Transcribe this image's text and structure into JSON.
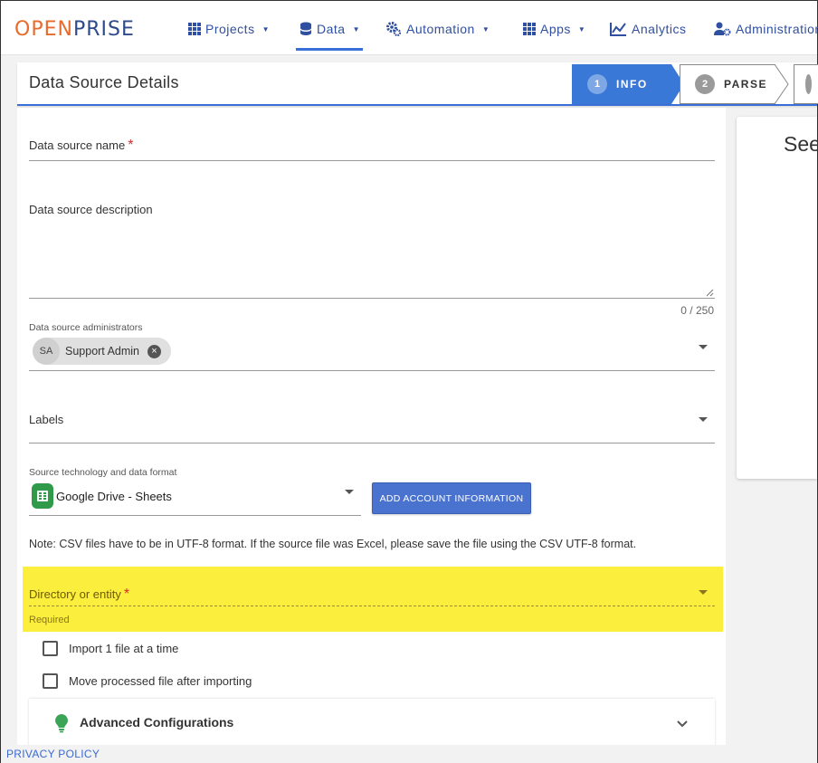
{
  "brand": {
    "open": "OPEN",
    "prise": "PRISE"
  },
  "nav": {
    "projects": "Projects",
    "data": "Data",
    "automation": "Automation",
    "apps": "Apps",
    "analytics": "Analytics",
    "administration": "Administration"
  },
  "header": {
    "title": "Data Source Details",
    "steps": [
      {
        "num": "1",
        "label": "INFO"
      },
      {
        "num": "2",
        "label": "PARSE"
      }
    ]
  },
  "side_panel": {
    "title": "See"
  },
  "form": {
    "name_label": "Data source name",
    "required_mark": "*",
    "description_label": "Data source description",
    "description_counter": "0 / 250",
    "admins_label": "Data source administrators",
    "admin_chip": {
      "initials": "SA",
      "name": "Support Admin"
    },
    "labels_label": "Labels",
    "source_label": "Source technology and data format",
    "source_value": "Google Drive - Sheets",
    "add_account_button": "ADD ACCOUNT INFORMATION",
    "note": "Note: CSV files have to be in UTF-8 format. If the source file was Excel, please save the file using the CSV UTF-8 format.",
    "directory_label": "Directory or entity",
    "directory_error": "Required",
    "import_one_label": "Import 1 file at a time",
    "move_processed_label": "Move processed file after importing",
    "advanced_title": "Advanced Configurations"
  },
  "footer": {
    "privacy": "PRIVACY POLICY"
  },
  "colors": {
    "accent": "#3a78d8",
    "brand_orange": "#e86a2c",
    "brand_blue": "#2d4a8a",
    "highlight": "#fbee3c",
    "required": "#d32f2f",
    "button": "#4a72cf"
  }
}
